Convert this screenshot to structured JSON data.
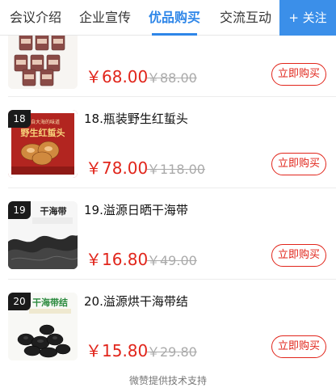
{
  "nav": {
    "tabs": [
      "会议介绍",
      "企业宣传",
      "优品购买",
      "交流互动"
    ],
    "active_index": 2,
    "follow_label": "+ 关注"
  },
  "products": [
    {
      "rank": "",
      "name": "",
      "price": "￥68.00",
      "original_price": "￥88.00",
      "buy_label": "立即购买"
    },
    {
      "rank": "18",
      "name": "18.瓶装野生红蜇头",
      "price": "￥78.00",
      "original_price": "￥118.00",
      "buy_label": "立即购买",
      "thumb_text_top": "来自大海的味道",
      "thumb_text": "野生红蜇头"
    },
    {
      "rank": "19",
      "name": "19.溢源日晒干海带",
      "price": "￥16.80",
      "original_price": "￥49.00",
      "buy_label": "立即购买",
      "thumb_text": "干海带"
    },
    {
      "rank": "20",
      "name": "20.溢源烘干海带结",
      "price": "￥15.80",
      "original_price": "￥29.80",
      "buy_label": "立即购买",
      "thumb_text": "干海带结"
    }
  ],
  "footer": {
    "text": "微赞提供技术支持"
  },
  "colors": {
    "accent": "#2e86e8",
    "price": "#e1251b",
    "follow_bg": "#3b8fe9"
  }
}
